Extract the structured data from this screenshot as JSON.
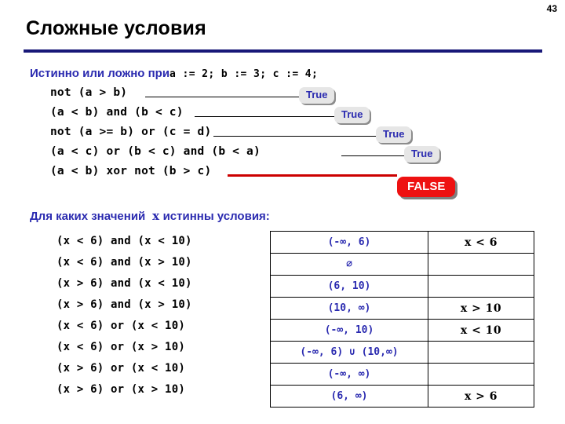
{
  "page_number": "43",
  "title": "Сложные условия",
  "accent_colors": {
    "rule": "#181878",
    "heading_blue": "#2b2bb0",
    "false_red": "#ee1111",
    "callout_gray": "#e6e6e6"
  },
  "question_one": {
    "label": "Истинно или ложно при",
    "assignments": "a := 2;  b := 3;  c := 4;"
  },
  "expressions": [
    {
      "code": "not (a > b)",
      "result": "True",
      "result_type": "true"
    },
    {
      "code": "(a < b) and (b < c)",
      "result": "True",
      "result_type": "true"
    },
    {
      "code": "not (a >= b) or (c = d)",
      "result": "True",
      "result_type": "true"
    },
    {
      "code": "(a < c) or (b < c) and (b < a)",
      "result": "True",
      "result_type": "true"
    },
    {
      "code": "(a < b) xor not (b > c)",
      "result": "FALSE",
      "result_type": "false"
    }
  ],
  "question_two": {
    "prefix": "Для каких значений",
    "variable": "x",
    "suffix": "истинны условия:"
  },
  "answer_table": {
    "rows": [
      {
        "condition": "(x < 6) and (x < 10)",
        "interval": "(-∞, 6)",
        "simple": "x < 6"
      },
      {
        "condition": "(x < 6) and (x > 10)",
        "interval": "∅",
        "simple": ""
      },
      {
        "condition": "(x > 6) and (x < 10)",
        "interval": "(6, 10)",
        "simple": ""
      },
      {
        "condition": "(x > 6) and (x > 10)",
        "interval": "(10, ∞)",
        "simple": "x > 10"
      },
      {
        "condition": "(x < 6) or (x < 10)",
        "interval": "(-∞, 10)",
        "simple": "x < 10"
      },
      {
        "condition": "(x < 6) or (x > 10)",
        "interval": "(-∞, 6) ∪ (10,∞)",
        "simple": ""
      },
      {
        "condition": "(x > 6) or (x < 10)",
        "interval": "(-∞, ∞)",
        "simple": ""
      },
      {
        "condition": "(x > 6) or (x > 10)",
        "interval": "(6, ∞)",
        "simple": "x > 6"
      }
    ]
  }
}
